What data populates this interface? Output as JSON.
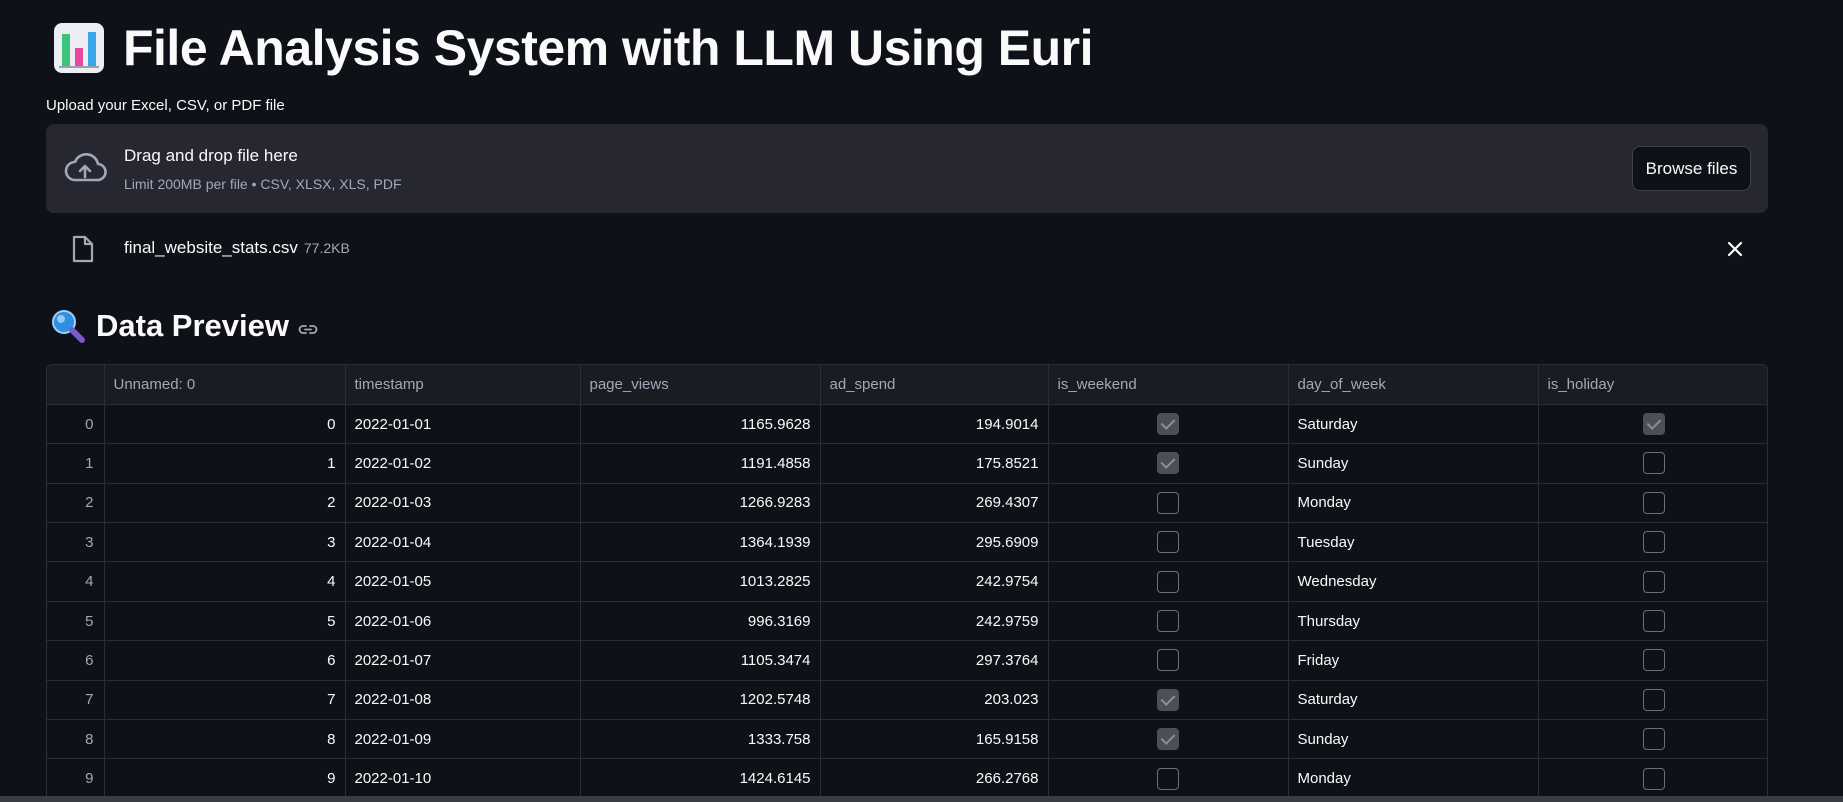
{
  "header": {
    "title": "File Analysis System with LLM Using Euri",
    "icon": "bar-chart-icon"
  },
  "uploader": {
    "label": "Upload your Excel, CSV, or PDF file",
    "drop_title": "Drag and drop file here",
    "drop_sub": "Limit 200MB per file • CSV, XLSX, XLS, PDF",
    "browse_label": "Browse files"
  },
  "file": {
    "name": "final_website_stats.csv",
    "size": "77.2KB"
  },
  "preview": {
    "title": "Data Preview",
    "icon": "magnifier-icon"
  },
  "table": {
    "columns": [
      "",
      "Unnamed: 0",
      "timestamp",
      "page_views",
      "ad_spend",
      "is_weekend",
      "day_of_week",
      "is_holiday"
    ],
    "rows": [
      {
        "idx": "0",
        "unnamed": "0",
        "timestamp": "2022-01-01",
        "page_views": "1165.9628",
        "ad_spend": "194.9014",
        "is_weekend": true,
        "day_of_week": "Saturday",
        "is_holiday": true
      },
      {
        "idx": "1",
        "unnamed": "1",
        "timestamp": "2022-01-02",
        "page_views": "1191.4858",
        "ad_spend": "175.8521",
        "is_weekend": true,
        "day_of_week": "Sunday",
        "is_holiday": false
      },
      {
        "idx": "2",
        "unnamed": "2",
        "timestamp": "2022-01-03",
        "page_views": "1266.9283",
        "ad_spend": "269.4307",
        "is_weekend": false,
        "day_of_week": "Monday",
        "is_holiday": false
      },
      {
        "idx": "3",
        "unnamed": "3",
        "timestamp": "2022-01-04",
        "page_views": "1364.1939",
        "ad_spend": "295.6909",
        "is_weekend": false,
        "day_of_week": "Tuesday",
        "is_holiday": false
      },
      {
        "idx": "4",
        "unnamed": "4",
        "timestamp": "2022-01-05",
        "page_views": "1013.2825",
        "ad_spend": "242.9754",
        "is_weekend": false,
        "day_of_week": "Wednesday",
        "is_holiday": false
      },
      {
        "idx": "5",
        "unnamed": "5",
        "timestamp": "2022-01-06",
        "page_views": "996.3169",
        "ad_spend": "242.9759",
        "is_weekend": false,
        "day_of_week": "Thursday",
        "is_holiday": false
      },
      {
        "idx": "6",
        "unnamed": "6",
        "timestamp": "2022-01-07",
        "page_views": "1105.3474",
        "ad_spend": "297.3764",
        "is_weekend": false,
        "day_of_week": "Friday",
        "is_holiday": false
      },
      {
        "idx": "7",
        "unnamed": "7",
        "timestamp": "2022-01-08",
        "page_views": "1202.5748",
        "ad_spend": "203.023",
        "is_weekend": true,
        "day_of_week": "Saturday",
        "is_holiday": false
      },
      {
        "idx": "8",
        "unnamed": "8",
        "timestamp": "2022-01-09",
        "page_views": "1333.758",
        "ad_spend": "165.9158",
        "is_weekend": true,
        "day_of_week": "Sunday",
        "is_holiday": false
      },
      {
        "idx": "9",
        "unnamed": "9",
        "timestamp": "2022-01-10",
        "page_views": "1424.6145",
        "ad_spend": "266.2768",
        "is_weekend": false,
        "day_of_week": "Monday",
        "is_holiday": false
      }
    ]
  },
  "colors": {
    "background": "#0e1117",
    "panel": "#262730",
    "text": "#fafafa",
    "muted": "#a3a8b8",
    "border": "#2b2e37"
  }
}
